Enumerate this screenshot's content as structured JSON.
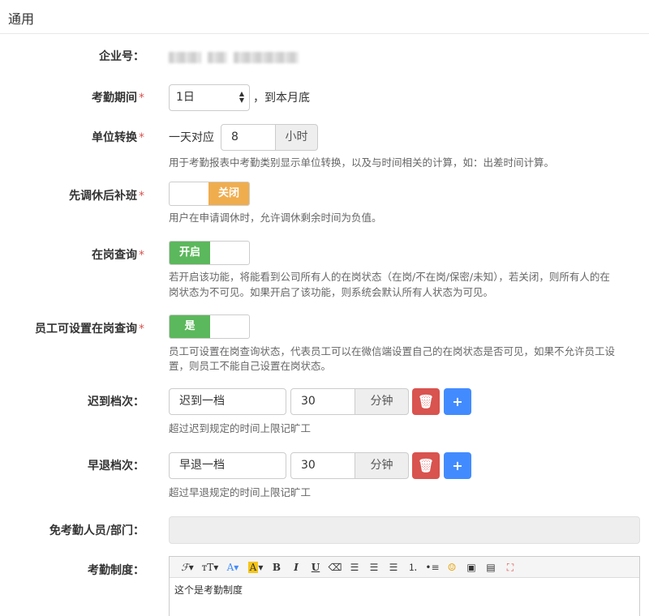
{
  "section": {
    "title": "通用"
  },
  "fields": {
    "company_id": {
      "label": "企业号："
    },
    "period": {
      "label": "考勤期间",
      "value": "1日",
      "suffix": "，到本月底"
    },
    "unit": {
      "label": "单位转换",
      "prefix": "一天对应",
      "value": "8",
      "addon": "小时",
      "hint": "用于考勤报表中考勤类别显示单位转换，以及与时间相关的计算，如：出差时间计算。"
    },
    "swap": {
      "label": "先调休后补班",
      "toggle": "关闭",
      "hint": "用户在申请调休时，允许调休剩余时间为负值。"
    },
    "presence": {
      "label": "在岗查询",
      "toggle": "开启",
      "hint1": "若开启该功能，将能看到公司所有人的在岗状态（在岗/不在岗/保密/未知），若关闭，则所有人的在",
      "hint2": "岗状态为不可见。如果开启了该功能，则系统会默认所有人状态为可见。"
    },
    "self_presence": {
      "label": "员工可设置在岗查询",
      "toggle": "是",
      "hint1": "员工可设置在岗查询状态，代表员工可以在微信端设置自己的在岗状态是否可见，如果不允许员工设",
      "hint2": "置，则员工不能自己设置在岗状态。"
    },
    "late": {
      "label": "迟到档次：",
      "name": "迟到一档",
      "minutes": "30",
      "unit": "分钟",
      "hint": "超过迟到规定的时间上限记旷工"
    },
    "early": {
      "label": "早退档次：",
      "name": "早退一档",
      "minutes": "30",
      "unit": "分钟",
      "hint": "超过早退规定的时间上限记旷工"
    },
    "exempt": {
      "label": "免考勤人员/部门："
    },
    "policy": {
      "label": "考勤制度：",
      "content": "这个是考勤制度"
    }
  },
  "required_mark": "*",
  "icons": {
    "delete": "trash-icon",
    "add": "plus-icon"
  },
  "colors": {
    "off": "#f0ad4e",
    "on": "#5cb85c",
    "delete": "#d9534f",
    "add": "#428bff",
    "required": "#d9534f"
  }
}
